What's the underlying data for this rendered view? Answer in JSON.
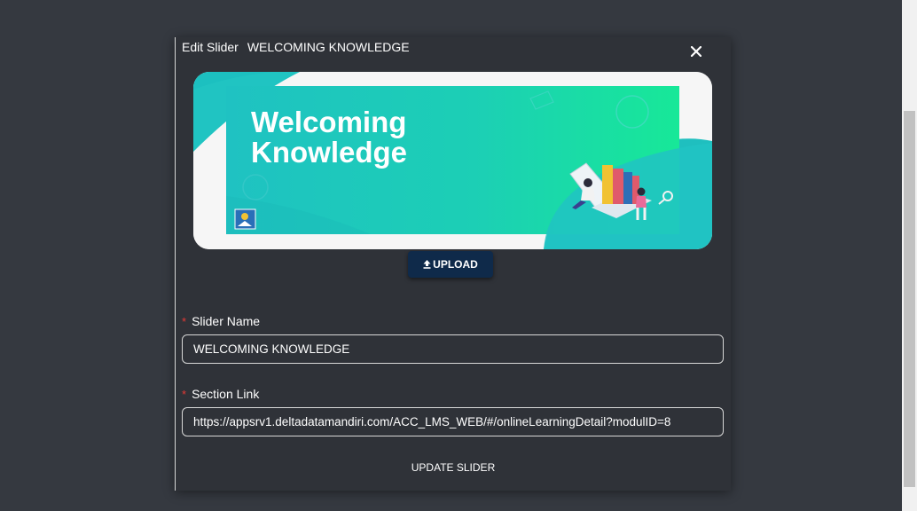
{
  "modal": {
    "title": "Edit Slider",
    "slider_name": "WELCOMING KNOWLEDGE",
    "close_icon": "close-icon"
  },
  "banner": {
    "line1": "Welcoming",
    "line2": "Knowledge"
  },
  "upload": {
    "label": "UPLOAD",
    "icon": "upload-icon"
  },
  "form": {
    "slider_name_label": "Slider Name",
    "slider_name_value": "WELCOMING KNOWLEDGE",
    "section_link_label": "Section Link",
    "section_link_value": "https://appsrv1.deltadatamandiri.com/ACC_LMS_WEB/#/onlineLearningDetail?modulID=8",
    "required_mark": "*"
  },
  "actions": {
    "update_label": "UPDATE SLIDER"
  },
  "colors": {
    "background": "#353940",
    "modal": "#2f3238",
    "upload_button": "#0f2a4a",
    "banner_teal": "#1fc2c2",
    "banner_green": "#19e596",
    "required": "#e53935"
  }
}
